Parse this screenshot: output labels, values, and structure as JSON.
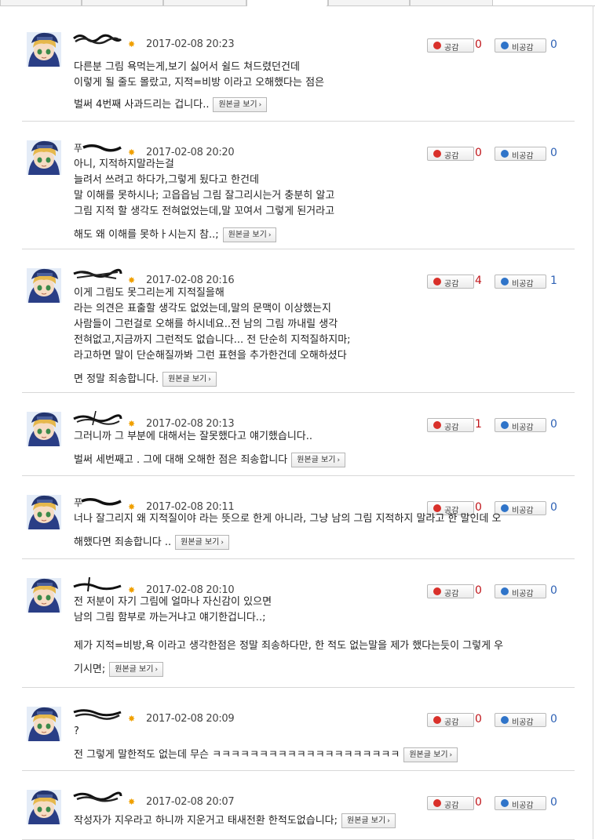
{
  "labels": {
    "like": "공감",
    "dislike": "비공감",
    "view_original": "원본글 보기"
  },
  "colors": {
    "like": "#d9302a",
    "dislike": "#2f74c9",
    "badge": "#f0a000"
  },
  "icons": {
    "badge": "sun-badge-icon",
    "like": "like-dot-icon",
    "dislike": "dislike-dot-icon",
    "avatar": "anime-avatar-icon"
  },
  "comments": [
    {
      "date": "2017-02-08 20:23",
      "likes": "0",
      "dislikes": "0",
      "lines": [
        "다른분 그림 욕먹는게,보기 싫어서 쉴드 쳐드렸던건데",
        "이렇게 될 줄도 몰랐고, 지적=비방 이라고 오해했다는 점은"
      ],
      "last": "벌써 4번째 사과드리는 겁니다.."
    },
    {
      "date": "2017-02-08 20:20",
      "likes": "0",
      "dislikes": "0",
      "lines": [
        "아니, 지적하지말라는걸",
        "늘려서 쓰려고 하다가,그렇게 됬다고 한건데",
        "말 이해를 못하시나; 고읍읍님 그림 잘그리시는거 충분히 알고",
        "그림 지적 할 생각도 전혀없었는데,말 꼬여서 그렇게 된거라고"
      ],
      "last": "해도 왜 이해를 못하ㅏ시는지 참..;"
    },
    {
      "date": "2017-02-08 20:16",
      "likes": "4",
      "dislikes": "1",
      "lines": [
        "이게 그림도 못그리는게 지적질을해",
        "라는 의견은 표출할 생각도 없었는데,말의 문맥이 이상했는지",
        "사람들이 그런걸로 오해를 하시네요..전 남의 그림 까내릴 생각",
        "전혀없고,지금까지 그런적도 없습니다... 전 단순히 지적질하지마;",
        "라고하면 말이 단순해질까봐 그런 표현을 추가한건데 오해하셨다"
      ],
      "last": "면 정말 죄송합니다."
    },
    {
      "date": "2017-02-08 20:13",
      "likes": "1",
      "dislikes": "0",
      "lines": [
        "그러니까 그 부분에 대해서는 잘못했다고 얘기했습니다.."
      ],
      "last": "벌써 세번째고 . 그에 대해 오해한 점은 죄송합니다"
    },
    {
      "date": "2017-02-08 20:11",
      "likes": "0",
      "dislikes": "0",
      "lines": [
        "너나 잘그리지 왜 지적질이야 라는 뜻으로 한게 아니라, 그냥 남의 그림 지적하지 말라고 한 말인데 오"
      ],
      "last": "해했다면 죄송합니다 .."
    },
    {
      "date": "2017-02-08 20:10",
      "likes": "0",
      "dislikes": "0",
      "lines": [
        "전 저분이 자기 그림에 얼마나 자신감이 있으면",
        "남의 그림 함부로 까는거냐고 얘기한겁니다..;",
        "",
        "제가 지적=비방,욕 이라고 생각한점은 정말 죄송하다만, 한 적도 없는말을 제가 했다는듯이 그렇게 우"
      ],
      "last": "기시면;"
    },
    {
      "date": "2017-02-08 20:09",
      "likes": "0",
      "dislikes": "0",
      "lines": [
        "?"
      ],
      "last": "전 그렇게 말한적도 없는데 무슨 ㅋㅋㅋㅋㅋㅋㅋㅋㅋㅋㅋㅋㅋㅋㅋㅋㅋㅋㅋㅋ"
    },
    {
      "date": "2017-02-08 20:07",
      "likes": "0",
      "dislikes": "0",
      "lines": [],
      "last": "작성자가 지우라고 하니까 지운거고 태새전환 한적도없습니다;"
    }
  ]
}
